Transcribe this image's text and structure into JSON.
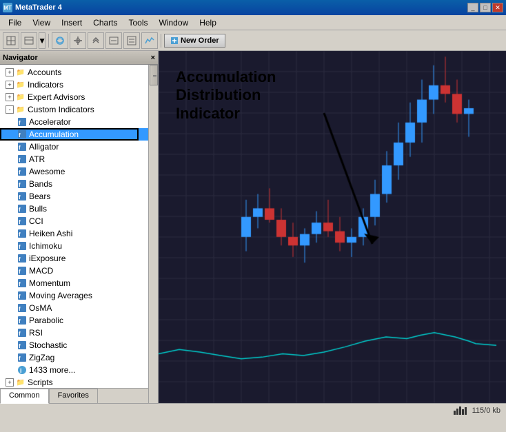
{
  "titleBar": {
    "appName": "MetaTrader 4",
    "icon": "MT",
    "controls": [
      "_",
      "□",
      "✕"
    ]
  },
  "menuBar": {
    "items": [
      "File",
      "View",
      "Insert",
      "Charts",
      "Tools",
      "Window",
      "Help"
    ]
  },
  "toolbar": {
    "newOrderLabel": "New Order"
  },
  "navigator": {
    "title": "Navigator",
    "closeLabel": "×",
    "tree": [
      {
        "id": "accounts",
        "label": "Accounts",
        "indent": 1,
        "type": "folder",
        "expanded": true
      },
      {
        "id": "indicators",
        "label": "Indicators",
        "indent": 1,
        "type": "folder",
        "expanded": false
      },
      {
        "id": "expert-advisors",
        "label": "Expert Advisors",
        "indent": 1,
        "type": "folder",
        "expanded": false
      },
      {
        "id": "custom-indicators",
        "label": "Custom Indicators",
        "indent": 1,
        "type": "folder",
        "expanded": true
      },
      {
        "id": "accelerator",
        "label": "Accelerator",
        "indent": 2,
        "type": "indicator"
      },
      {
        "id": "accumulation",
        "label": "Accumulation",
        "indent": 2,
        "type": "indicator",
        "selected": true
      },
      {
        "id": "alligator",
        "label": "Alligator",
        "indent": 2,
        "type": "indicator"
      },
      {
        "id": "atr",
        "label": "ATR",
        "indent": 2,
        "type": "indicator"
      },
      {
        "id": "awesome",
        "label": "Awesome",
        "indent": 2,
        "type": "indicator"
      },
      {
        "id": "bands",
        "label": "Bands",
        "indent": 2,
        "type": "indicator"
      },
      {
        "id": "bears",
        "label": "Bears",
        "indent": 2,
        "type": "indicator"
      },
      {
        "id": "bulls",
        "label": "Bulls",
        "indent": 2,
        "type": "indicator"
      },
      {
        "id": "cci",
        "label": "CCI",
        "indent": 2,
        "type": "indicator"
      },
      {
        "id": "heiken-ashi",
        "label": "Heiken Ashi",
        "indent": 2,
        "type": "indicator"
      },
      {
        "id": "ichimoku",
        "label": "Ichimoku",
        "indent": 2,
        "type": "indicator"
      },
      {
        "id": "iexposure",
        "label": "iExposure",
        "indent": 2,
        "type": "indicator"
      },
      {
        "id": "macd",
        "label": "MACD",
        "indent": 2,
        "type": "indicator"
      },
      {
        "id": "momentum",
        "label": "Momentum",
        "indent": 2,
        "type": "indicator"
      },
      {
        "id": "moving-averages",
        "label": "Moving Averages",
        "indent": 2,
        "type": "indicator"
      },
      {
        "id": "osma",
        "label": "OsMA",
        "indent": 2,
        "type": "indicator"
      },
      {
        "id": "parabolic",
        "label": "Parabolic",
        "indent": 2,
        "type": "indicator"
      },
      {
        "id": "rsi",
        "label": "RSI",
        "indent": 2,
        "type": "indicator"
      },
      {
        "id": "stochastic",
        "label": "Stochastic",
        "indent": 2,
        "type": "indicator"
      },
      {
        "id": "zigzag",
        "label": "ZigZag",
        "indent": 2,
        "type": "indicator"
      },
      {
        "id": "more",
        "label": "1433 more...",
        "indent": 2,
        "type": "more"
      },
      {
        "id": "scripts",
        "label": "Scripts",
        "indent": 1,
        "type": "folder",
        "expanded": false
      }
    ],
    "tabs": [
      {
        "id": "common",
        "label": "Common",
        "active": true
      },
      {
        "id": "favorites",
        "label": "Favorites",
        "active": false
      }
    ]
  },
  "annotation": {
    "line1": "Accumulation",
    "line2": "Distribution",
    "line3": "Indicator"
  },
  "statusBar": {
    "memory": "115/0 kb"
  },
  "colors": {
    "background": "#d4d0c8",
    "titleBarStart": "#0a5fa8",
    "titleBarEnd": "#0843a0",
    "chartBg": "#000010",
    "bullCandle": "#3399ff",
    "bearCandle": "#cc2222",
    "indicatorLine": "#00cccc"
  }
}
